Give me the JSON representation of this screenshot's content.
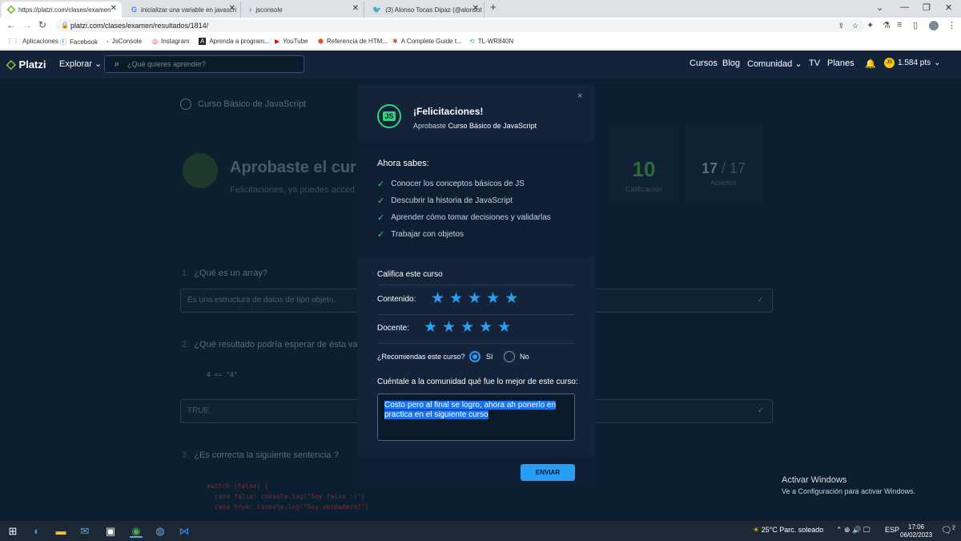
{
  "browser": {
    "tabs": [
      {
        "title": "https://platzi.com/clases/examen"
      },
      {
        "title": "inicializar una variable en javascri"
      },
      {
        "title": "jsconsole"
      },
      {
        "title": "(3) Alonso Tocas Dipaz (@alonsot"
      }
    ],
    "url": "platzi.com/clases/examen/resultados/1814/",
    "bookmarks": [
      "Aplicaciones",
      "Facebook",
      "JsConsole",
      "Instagram",
      "Aprenda a program...",
      "YouTube",
      "Referencia de HTM...",
      "A Complete Guide t...",
      "TL-WR840N"
    ]
  },
  "site": {
    "logo": "Platzi",
    "explorar": "Explorar",
    "search_placeholder": "¿Qué quieres aprender?",
    "nav": [
      "Cursos",
      "Blog",
      "Comunidad",
      "TV",
      "Planes"
    ],
    "points": "1.584 pts",
    "avatar_initials": "JS"
  },
  "background": {
    "course_title": "Curso Básico de JavaScript",
    "result_title": "Aprobaste el curso",
    "result_sub": "Felicitaciones, ya puedes acced",
    "score": "10",
    "score_label": "Calificación",
    "hits": "17",
    "hits_total": "/ 17",
    "hits_label": "Aciertos",
    "questions": [
      {
        "num": "1.",
        "text": "¿Qué es un array?",
        "answer": "Es una estructura de datos de tipo objeto."
      },
      {
        "num": "2.",
        "text": "¿Qué resultado podría esperar de ésta va",
        "code": "4 == \"4\"",
        "answer": "TRUE"
      },
      {
        "num": "3.",
        "text": "¿Es correcta la siguiente sentencia ?"
      }
    ],
    "code_lines": [
      "switch (false) {",
      "case false: console.log(\"Soy falso :(\")",
      "case true: console.log(\"Soy verdadero!\")"
    ]
  },
  "modal": {
    "badge": "JS",
    "title": "¡Felicitaciones!",
    "subtitle_prefix": "Aprobaste",
    "subtitle_course": "Curso Básico de JavaScript",
    "close": "×",
    "learned_heading": "Ahora sabes:",
    "learned": [
      "Conocer los conceptos básicos de JS",
      "Descubrir la historia de JavaScript",
      "Aprender cómo tomar decisiones y validarlas",
      "Trabajar con objetos"
    ],
    "rate_heading": "Califica este curso",
    "ratings": [
      {
        "label": "Contenido:",
        "stars": 5,
        "max": 5
      },
      {
        "label": "Docente:",
        "stars": 5,
        "max": 5
      }
    ],
    "recommend_label": "¿Recomiendas este curso?",
    "recommend_yes": "Sí",
    "recommend_no": "No",
    "recommend_value": "Sí",
    "comment_label": "Cuéntale a la comunidad qué fue lo mejor de este curso:",
    "comment_value": "Costo pero al final se logro, ahora ah ponerlo en practica en el siguiente curso",
    "submit": "ENVIAR"
  },
  "windows": {
    "activate_title": "Activar Windows",
    "activate_sub": "Ve a Configuración para activar Windows.",
    "weather": "25°C  Parc. soleado",
    "lang": "ESP",
    "time": "17:06",
    "date": "06/02/2023",
    "notif_count": "2"
  },
  "colors": {
    "accent": "#2a9df4",
    "success": "#2ed37a",
    "page_bg": "#0b1f30",
    "modal_bg": "#13233a"
  }
}
